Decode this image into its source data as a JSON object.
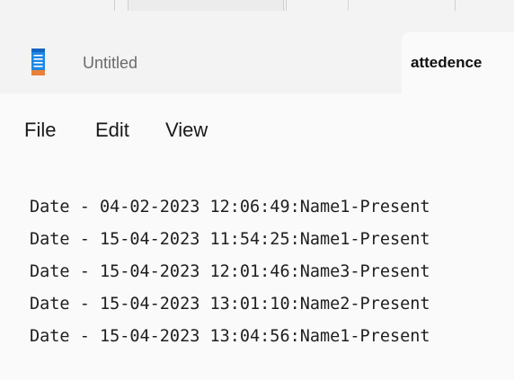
{
  "tabs": {
    "untitled_label": "Untitled",
    "active_label": "attedence"
  },
  "app_icon": "notepad-icon",
  "menu": {
    "file": "File",
    "edit": "Edit",
    "view": "View"
  },
  "editor": {
    "lines": [
      "Date - 04-02-2023 12:06:49:Name1-Present",
      "Date - 15-04-2023 11:54:25:Name1-Present",
      "Date - 15-04-2023 12:01:46:Name3-Present",
      "Date - 15-04-2023 13:01:10:Name2-Present",
      "Date - 15-04-2023 13:04:56:Name1-Present"
    ]
  },
  "colors": {
    "icon_blue": "#1e88e5",
    "icon_orange": "#e8813a",
    "tabbar_bg": "#f3f3f3",
    "editor_bg": "#fafafa"
  }
}
